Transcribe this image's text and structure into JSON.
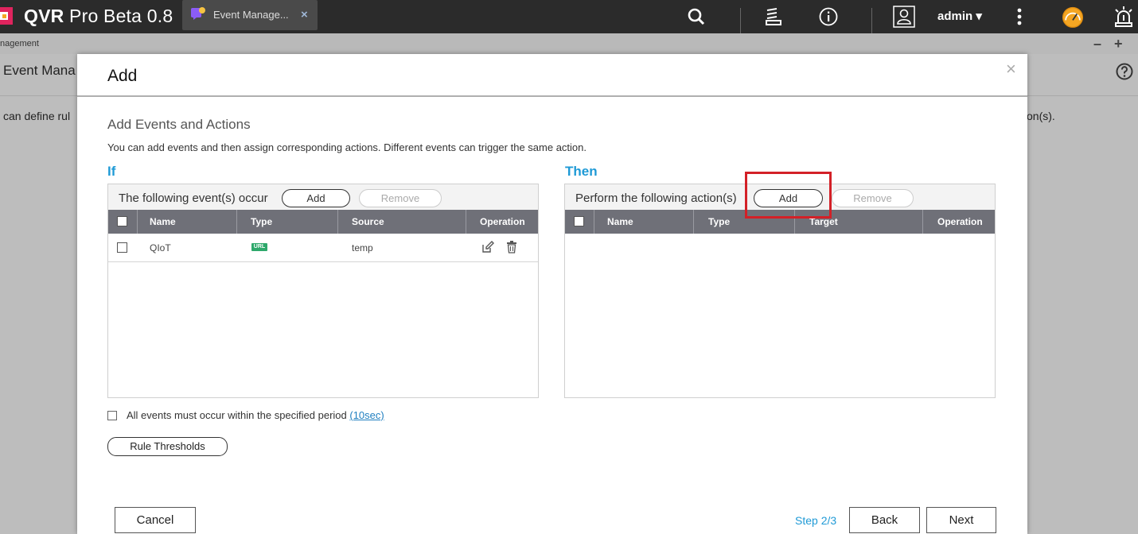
{
  "app": {
    "title_bold": "QVR",
    "title_rest": "Pro Beta 0.8"
  },
  "tab": {
    "label": "Event Manage...",
    "close": "×"
  },
  "topbar": {
    "icons": [
      "search-icon",
      "task-queue-icon",
      "info-icon",
      "user-icon",
      "more-icon",
      "dashboard-gauge-icon",
      "alarm-icon"
    ],
    "user": "admin ▾"
  },
  "background": {
    "breadcrumb": "nagement",
    "title": "Event Mana",
    "desc_left": "can define rul",
    "desc_right": "on(s).",
    "minimize": "–",
    "add": "+"
  },
  "modal": {
    "title": "Add",
    "close": "×",
    "section_title": "Add Events and Actions",
    "section_desc": "You can add events and then assign corresponding actions. Different events can trigger the same action.",
    "if_label": "If",
    "then_label": "Then",
    "events": {
      "header": "The following event(s) occur",
      "add": "Add",
      "remove": "Remove",
      "columns": [
        "Name",
        "Type",
        "Source",
        "Operation"
      ],
      "rows": [
        {
          "name": "QIoT",
          "type": "URL",
          "source": "temp"
        }
      ]
    },
    "actions": {
      "header": "Perform the following action(s)",
      "add": "Add",
      "remove": "Remove",
      "columns": [
        "Name",
        "Type",
        "Target",
        "Operation"
      ]
    },
    "period_checkbox": {
      "text": "All events must occur within the specified period ",
      "link": "(10sec)"
    },
    "rule_thresholds": "Rule Thresholds",
    "footer": {
      "cancel": "Cancel",
      "step": "Step 2/3",
      "back": "Back",
      "next": "Next"
    }
  },
  "colors": {
    "accent_blue": "#1f9ad6",
    "table_header": "#6f7078",
    "highlight_red": "#d32027",
    "url_badge": "#2ea86b"
  }
}
